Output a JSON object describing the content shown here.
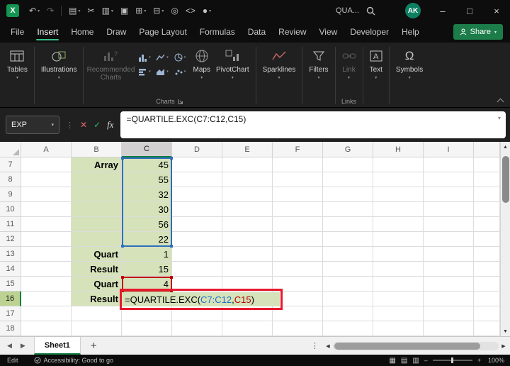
{
  "titlebar": {
    "search_text": "QUA...",
    "avatar_initials": "AK",
    "quick_access": [
      {
        "name": "undo-icon",
        "caret": true
      },
      {
        "name": "redo-icon",
        "disabled": true
      },
      {
        "name": "workbook-icon",
        "caret": true
      },
      {
        "name": "cut-icon"
      },
      {
        "name": "chart-icon",
        "caret": true
      },
      {
        "name": "picture-icon"
      },
      {
        "name": "table-icon",
        "caret": true
      },
      {
        "name": "borders-icon",
        "caret": true
      },
      {
        "name": "camera-icon"
      },
      {
        "name": "code-icon"
      },
      {
        "name": "record-macro-icon",
        "caret": true
      }
    ]
  },
  "menubar": {
    "items": [
      {
        "label": "File"
      },
      {
        "label": "Insert",
        "active": true
      },
      {
        "label": "Home"
      },
      {
        "label": "Draw"
      },
      {
        "label": "Page Layout"
      },
      {
        "label": "Formulas"
      },
      {
        "label": "Data"
      },
      {
        "label": "Review"
      },
      {
        "label": "View"
      },
      {
        "label": "Developer"
      },
      {
        "label": "Help"
      }
    ],
    "share_label": "Share"
  },
  "ribbon": {
    "buttons": [
      {
        "label": "Tables"
      },
      {
        "label": "Illustrations"
      },
      {
        "label": "Recommended Charts",
        "disabled": true
      },
      {
        "label": "Maps"
      },
      {
        "label": "PivotChart"
      },
      {
        "label": "Sparklines"
      },
      {
        "label": "Filters"
      },
      {
        "label": "Link",
        "disabled": true
      },
      {
        "label": "Text"
      },
      {
        "label": "Symbols"
      }
    ],
    "group_labels": {
      "charts": "Charts",
      "links": "Links"
    }
  },
  "formula_bar": {
    "name_box_value": "EXP",
    "fx_label": "fx",
    "formula": "=QUARTILE.EXC(C7:C12,C15)"
  },
  "grid": {
    "column_headers": [
      "A",
      "B",
      "C",
      "D",
      "E",
      "F",
      "G",
      "H",
      "I"
    ],
    "active_column": "C",
    "row_start": 7,
    "row_headers": [
      "7",
      "8",
      "9",
      "10",
      "11",
      "12",
      "13",
      "14",
      "15",
      "16",
      "17",
      "18"
    ],
    "active_row": "16",
    "cells": [
      {
        "ref": "B7",
        "text": "Array",
        "bold": true,
        "fill": true
      },
      {
        "ref": "B8",
        "fill": true
      },
      {
        "ref": "B9",
        "fill": true
      },
      {
        "ref": "B10",
        "fill": true
      },
      {
        "ref": "B11",
        "fill": true
      },
      {
        "ref": "B12",
        "fill": true
      },
      {
        "ref": "C7",
        "text": "45",
        "fill": true
      },
      {
        "ref": "C8",
        "text": "55",
        "fill": true
      },
      {
        "ref": "C9",
        "text": "32",
        "fill": true
      },
      {
        "ref": "C10",
        "text": "30",
        "fill": true
      },
      {
        "ref": "C11",
        "text": "56",
        "fill": true
      },
      {
        "ref": "C12",
        "text": "22",
        "fill": true
      },
      {
        "ref": "B13",
        "text": "Quart",
        "bold": true,
        "fill": true
      },
      {
        "ref": "C13",
        "text": "1",
        "fill": true
      },
      {
        "ref": "B14",
        "text": "Result",
        "bold": true,
        "fill": true
      },
      {
        "ref": "C14",
        "text": "15",
        "fill": true
      },
      {
        "ref": "B15",
        "text": "Quart",
        "bold": true,
        "fill": true
      },
      {
        "ref": "C15",
        "text": "4",
        "fill": true
      },
      {
        "ref": "B16",
        "text": "Result",
        "bold": true,
        "fill": true
      },
      {
        "ref": "C16",
        "fill": true
      }
    ],
    "edit_cell": {
      "ref": "C16",
      "parts": [
        {
          "text": "=QUARTILE.EXC(",
          "color": "#000000"
        },
        {
          "text": "C7:C12",
          "color": "#1f6ec9"
        },
        {
          "text": ",",
          "color": "#000000"
        },
        {
          "text": "C15",
          "color": "#b80000"
        },
        {
          "text": ")",
          "color": "#000000"
        }
      ]
    },
    "highlights": {
      "blue_range": {
        "from": "C7",
        "to": "C12",
        "color": "#2f6dbf"
      },
      "red_cell": {
        "ref": "C15",
        "color": "#c00000"
      },
      "annotation_color": "#e8192c"
    }
  },
  "sheet_tabs": {
    "tabs": [
      {
        "label": "Sheet1",
        "active": true
      }
    ],
    "add_button": "+"
  },
  "status_bar": {
    "mode": "Edit",
    "accessibility_text": "Accessibility: Good to go",
    "zoom_value": "100%"
  },
  "colors": {
    "excel_green": "#107c41",
    "fill_green": "#d5e2ba",
    "ref_blue": "#1f6ec9",
    "ref_red": "#b80000",
    "annotation_red": "#e8192c",
    "header_selected_gray": "#d2d0d0",
    "row_selected_green": "#bcd292"
  }
}
